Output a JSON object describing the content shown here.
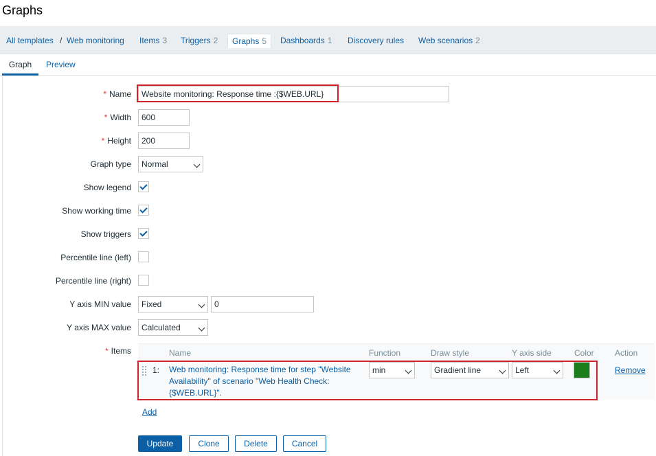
{
  "page": {
    "title": "Graphs"
  },
  "nav": {
    "all_templates": "All templates",
    "separator": "/",
    "web_monitoring": "Web monitoring",
    "items": {
      "label": "Items",
      "count": "3"
    },
    "triggers": {
      "label": "Triggers",
      "count": "2"
    },
    "graphs": {
      "label": "Graphs",
      "count": "5"
    },
    "dashboards": {
      "label": "Dashboards",
      "count": "1"
    },
    "discovery_rules": {
      "label": "Discovery rules"
    },
    "web_scenarios": {
      "label": "Web scenarios",
      "count": "2"
    }
  },
  "tabs": {
    "graph": "Graph",
    "preview": "Preview"
  },
  "form": {
    "name_label": "Name",
    "name_value": "Website monitoring: Response time :{$WEB.URL}",
    "width_label": "Width",
    "width_value": "600",
    "height_label": "Height",
    "height_value": "200",
    "graph_type_label": "Graph type",
    "graph_type_value": "Normal",
    "show_legend_label": "Show legend",
    "show_legend_checked": true,
    "show_working_time_label": "Show working time",
    "show_working_time_checked": true,
    "show_triggers_label": "Show triggers",
    "show_triggers_checked": true,
    "percentile_left_label": "Percentile line (left)",
    "percentile_left_checked": false,
    "percentile_right_label": "Percentile line (right)",
    "percentile_right_checked": false,
    "y_min_label": "Y axis MIN value",
    "y_min_type": "Fixed",
    "y_min_value": "0",
    "y_max_label": "Y axis MAX value",
    "y_max_type": "Calculated",
    "items_label": "Items",
    "required_mark": "*"
  },
  "items_table": {
    "headers": {
      "name": "Name",
      "function": "Function",
      "draw_style": "Draw style",
      "y_axis_side": "Y axis side",
      "color": "Color",
      "action": "Action"
    },
    "rows": [
      {
        "index": "1:",
        "name_line1": "Web monitoring: Response time for step \"Website",
        "name_line2": "Availability\" of scenario \"Web Health Check:",
        "name_line3": "{$WEB.URL}\".",
        "function": "min",
        "draw_style": "Gradient line",
        "y_axis_side": "Left",
        "color": "#1a7d1a",
        "action": "Remove"
      }
    ],
    "add_label": "Add"
  },
  "buttons": {
    "update": "Update",
    "clone": "Clone",
    "delete": "Delete",
    "cancel": "Cancel"
  },
  "colors": {
    "accent": "#0b5fa5",
    "highlight": "#d1232c",
    "required": "#e33734"
  }
}
